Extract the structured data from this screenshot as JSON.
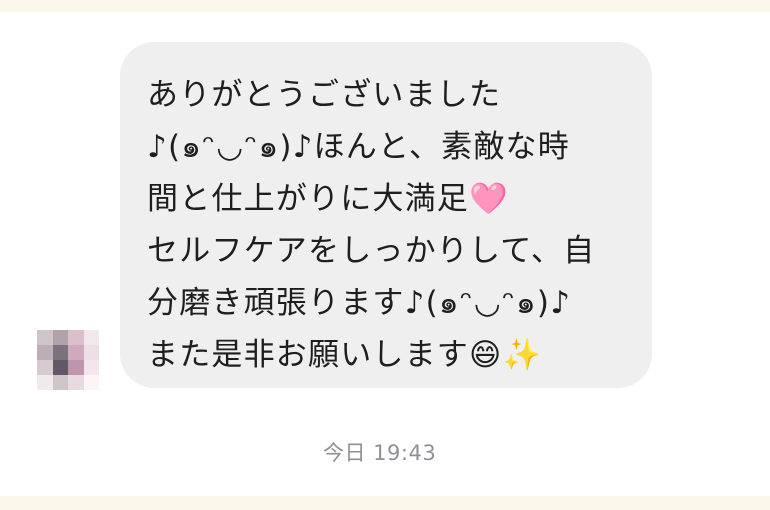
{
  "colors": {
    "band": "#fbf7ea",
    "bubble": "#efeff0",
    "text": "#1e1e1e",
    "timestamp": "#8f9096"
  },
  "message": {
    "lines": [
      "ありがとうございました",
      "♪(๑ᵔ◡ᵔ๑)♪ほんと、素敵な時",
      "間と仕上がりに大満足🩷",
      "セルフケアをしっかりして、自",
      "分磨き頑張ります♪(๑ᵔ◡ᵔ๑)♪",
      "また是非お願いします😄✨"
    ],
    "timestamp": "今日 19:43"
  },
  "avatar": {
    "icon": "blurred-profile-avatar",
    "pixels": [
      "#c9bfc4",
      "#a89aa3",
      "#d8b9c6",
      "#f0e6ea",
      "#b6a5af",
      "#6e6270",
      "#caa0b8",
      "#eadce3",
      "#d3c6cc",
      "#4f4659",
      "#b98aa6",
      "#f3e3ea",
      "#efe8ea",
      "#c8bfc3",
      "#e6d7dd",
      "#fbf5f7"
    ]
  }
}
